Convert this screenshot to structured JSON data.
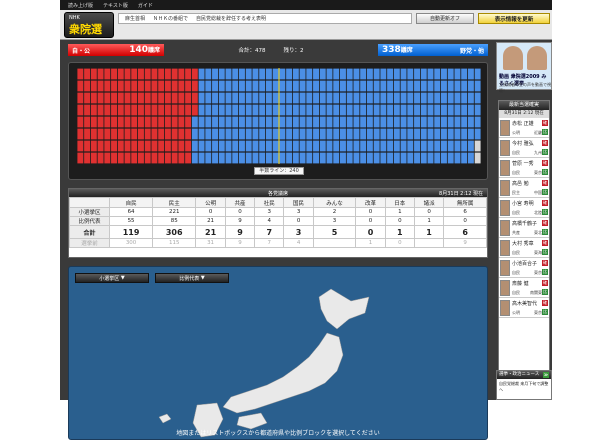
{
  "topbar": {
    "items": [
      "読み上げ版",
      "テキスト版",
      "ガイド"
    ]
  },
  "header": {
    "logo_small": "NHK",
    "logo_main": "衆院選",
    "ticker": [
      "麻生首相",
      "ＮＨＫの番組で",
      "自民党総裁を辞任する考え表明"
    ],
    "auto_update": "自動更新オフ",
    "show_latest": "表示情報を更新"
  },
  "totals": {
    "ruling_label": "自・公",
    "ruling_seats": "140",
    "ruling_unit": "議席",
    "total_label": "合計：478",
    "remaining_label": "残り：2",
    "opposition_seats": "338",
    "opposition_unit": "議席",
    "opposition_label": "野党・他"
  },
  "seatboard": {
    "half_line_label": "半数ライン：240",
    "ruling": 140,
    "opposition": 338,
    "remaining": 2,
    "colors": {
      "ruling": "#e03131",
      "opposition": "#4b8fe6",
      "remaining": "#d7d7d7"
    }
  },
  "party_table": {
    "title": "各党議席",
    "date": "8月31日 2:12 現在",
    "parties": [
      "自民",
      "民主",
      "公明",
      "共産",
      "社民",
      "国民",
      "みんな",
      "改革",
      "日本",
      "諸派",
      "無所属"
    ],
    "rows": [
      {
        "label": "小選挙区",
        "values": [
          "64",
          "221",
          "0",
          "0",
          "3",
          "3",
          "2",
          "0",
          "1",
          "0",
          "6"
        ]
      },
      {
        "label": "比例代表",
        "values": [
          "55",
          "85",
          "21",
          "9",
          "4",
          "0",
          "3",
          "0",
          "0",
          "1",
          "0"
        ]
      },
      {
        "label": "合計",
        "values": [
          "119",
          "306",
          "21",
          "9",
          "7",
          "3",
          "5",
          "0",
          "1",
          "1",
          "6"
        ]
      },
      {
        "label": "選挙前",
        "values": [
          "300",
          "115",
          "31",
          "9",
          "7",
          "4",
          "",
          "1",
          "0",
          "",
          "9"
        ]
      }
    ]
  },
  "map": {
    "tab_district": "小選挙区",
    "tab_pr": "比例代表",
    "message": "地図またはリストボックスから都道府県や比例ブロックを選択してください"
  },
  "banner": {
    "title": "動画 衆院選2009 みるさく選挙",
    "subtitle": "立候補者の生の声を動画で視聴！"
  },
  "winners": {
    "title": "最新当選確実",
    "time": "8月31日 2:12 現在",
    "list": [
      {
        "name": "赤松 正雄",
        "party": "公明",
        "region": "近畿",
        "b1": "確",
        "b2": "比"
      },
      {
        "name": "今村 雅弘",
        "party": "自民",
        "region": "九州",
        "b1": "確",
        "b2": "比"
      },
      {
        "name": "菅原 一秀",
        "party": "自民",
        "region": "東京",
        "b1": "確",
        "b2": "比"
      },
      {
        "name": "高邑 勉",
        "party": "民主",
        "region": "中国",
        "b1": "確",
        "b2": "比"
      },
      {
        "name": "小宮 寿明",
        "party": "自民",
        "region": "北陸",
        "b1": "確",
        "b2": "比"
      },
      {
        "name": "高橋千鶴子",
        "party": "共産",
        "region": "東北",
        "b1": "確",
        "b2": "比"
      },
      {
        "name": "大村 秀章",
        "party": "自民",
        "region": "東海",
        "b1": "確",
        "b2": "比"
      },
      {
        "name": "小池百合子",
        "party": "自民",
        "region": "東京",
        "b1": "確",
        "b2": "比"
      },
      {
        "name": "斎藤 健",
        "party": "自民",
        "region": "南関東",
        "b1": "確",
        "b2": "比"
      },
      {
        "name": "高木美智代",
        "party": "公明",
        "region": "東京",
        "b1": "確",
        "b2": "比"
      }
    ]
  },
  "news": {
    "title": "選挙・政治ニュース",
    "more": "≫",
    "item": "自民党総裁 来月下旬で調整へ"
  }
}
